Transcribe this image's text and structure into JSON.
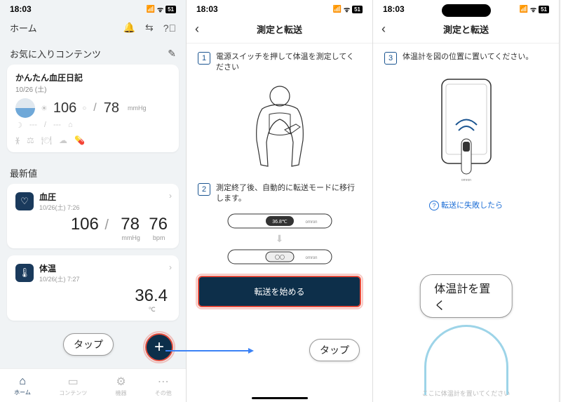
{
  "status": {
    "time": "18:03",
    "signal": "𝗅𝗅𝗅",
    "wifi": "ᯤ",
    "battery": "51"
  },
  "s1": {
    "home_label": "ホーム",
    "fav_title": "お気に入りコンテンツ",
    "diary": {
      "title": "かんたん血圧日記",
      "date": "10/26 (土)",
      "sys": "106",
      "dia": "78",
      "dia_marker": "○",
      "unit": "mmHg",
      "dash": "---"
    },
    "latest_title": "最新値",
    "bp": {
      "name": "血圧",
      "dt": "10/26(土) 7:26",
      "sys": "106",
      "dia": "78",
      "unit": "mmHg",
      "pulse": "76",
      "pulse_unit": "bpm"
    },
    "temp": {
      "name": "体温",
      "dt": "10/26(土) 7:27",
      "val": "36.4",
      "unit": "℃"
    },
    "tap_label": "タップ",
    "tabs": {
      "home": "ホーム",
      "contents": "コンテンツ",
      "device": "機器",
      "other": "その他"
    }
  },
  "s2": {
    "title": "測定と転送",
    "step1": "電源スイッチを押して体温を測定してください",
    "step2": "測定終了後、自動的に転送モードに移行します。",
    "thermo_reading": "36.8℃",
    "thermo_wait": "〇〇",
    "brand": "omron",
    "btn": "転送を始める",
    "tap_label": "タップ"
  },
  "s3": {
    "title": "測定と転送",
    "step3": "体温計を図の位置に置いてください。",
    "brand": "omron",
    "help": "転送に失敗したら",
    "callout": "体温計を置く",
    "place_hint": "ここに体温計を置いてください"
  }
}
